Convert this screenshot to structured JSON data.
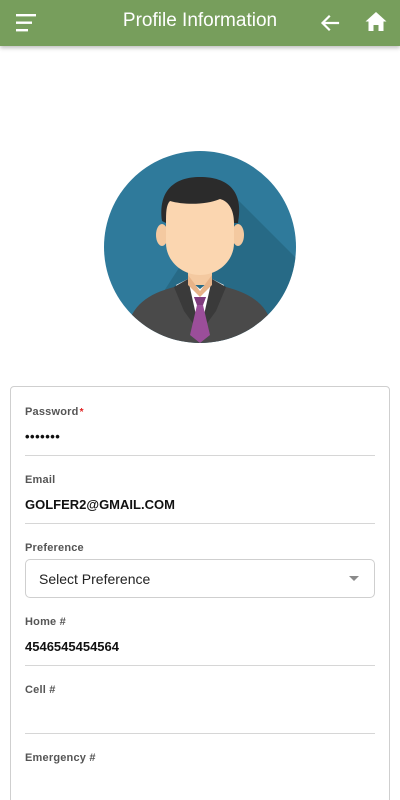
{
  "header": {
    "title": "Profile Information",
    "menu_icon": "hamburger-menu-icon",
    "back_icon": "arrow-left-icon",
    "home_icon": "home-icon",
    "bar_color": "#779e5c"
  },
  "avatar": {
    "icon": "user-avatar",
    "background_color": "#2f7a9b"
  },
  "form": {
    "password": {
      "label": "Password",
      "required_mark": "*",
      "value": "•••••••"
    },
    "email": {
      "label": "Email",
      "value": "GOLFER2@GMAIL.COM"
    },
    "preference": {
      "label": "Preference",
      "selected": "Select Preference"
    },
    "home": {
      "label": "Home #",
      "value": "4546545454564"
    },
    "cell": {
      "label": "Cell #",
      "value": ""
    },
    "emergency": {
      "label": "Emergency #",
      "value": ""
    }
  }
}
